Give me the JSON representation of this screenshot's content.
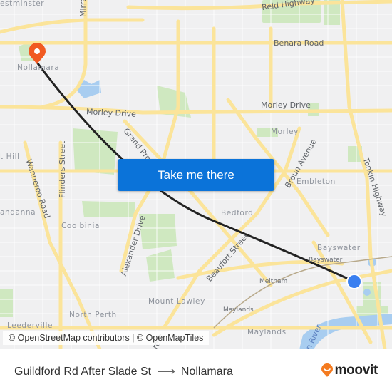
{
  "map": {
    "labels": {
      "westminster": "estminster",
      "mirrabooka": "Mirra",
      "reid_highway": "Reid Highway",
      "benara_road": "Benara Road",
      "nollamara": "Nollamara",
      "morley_drive_west": "Morley Drive",
      "morley_drive_east": "Morley Drive",
      "grand_promenade": "Grand Prom",
      "morley": "Morley",
      "broun_avenue": "Broun Avenue",
      "embleton": "Embleton",
      "tonkin_highway": "Tonkin Highway",
      "hill": "t Hill",
      "wanneroo_road": "Wanneroo Road",
      "flinders_street": "Flinders Street",
      "dianella": "andanna",
      "coolbinia": "Coolbinia",
      "bedford": "Bedford",
      "alexander_drive": "Alexander Drive",
      "beaufort_street": "Beaufort Street",
      "bayswater_suburb": "Bayswater",
      "bayswater_station": "Bayswater",
      "meltham": "Meltham",
      "mount_lawley": "Mount Lawley",
      "maylands_station": "Maylands",
      "maylands_suburb": "Maylands",
      "north_perth": "North Perth",
      "leederville": "Leederville",
      "swan_river": "n River",
      "street_partial": "reet"
    },
    "origin_marker": {
      "icon": "origin-dot-icon",
      "color": "#3a7ff0"
    },
    "destination_marker": {
      "icon": "map-pin-icon",
      "color": "#f15a22"
    },
    "route_color": "#222222",
    "attribution": "© OpenStreetMap contributors | © OpenMapTiles"
  },
  "cta": {
    "label": "Take me there",
    "color": "#0b73d9"
  },
  "footer": {
    "origin": "Guildford Rd After Slade St",
    "arrow": "⟶",
    "destination": "Nollamara",
    "brand": {
      "name": "moovit",
      "icon": "moovit-pin-icon",
      "color": "#f47b20"
    }
  }
}
